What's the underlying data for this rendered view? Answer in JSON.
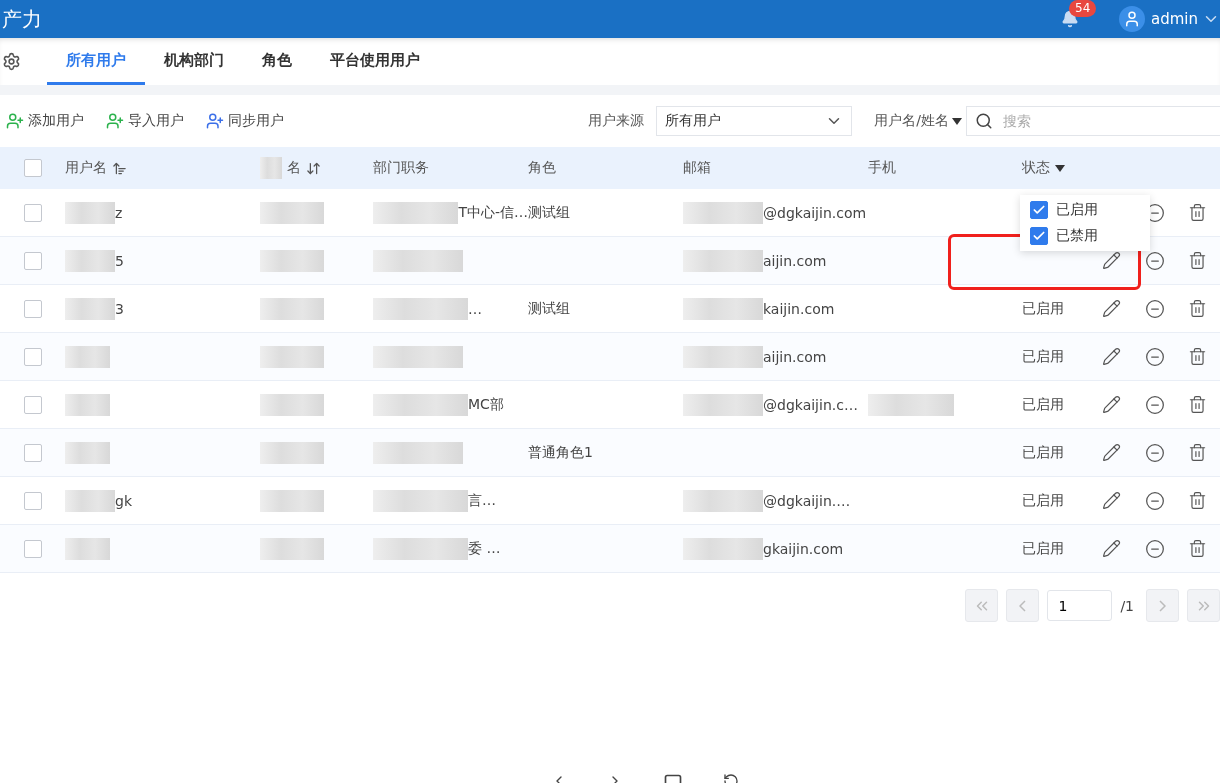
{
  "header": {
    "title": "产力",
    "notification_count": "54",
    "user": "admin"
  },
  "tabs": [
    {
      "label": "所有用户",
      "selected": true
    },
    {
      "label": "机构部门",
      "selected": false
    },
    {
      "label": "角色",
      "selected": false
    },
    {
      "label": "平台使用用户",
      "selected": false
    }
  ],
  "toolbar": {
    "actions": [
      "添加用户",
      "导入用户",
      "同步用户"
    ],
    "source_label": "用户来源",
    "source_value": "所有用户",
    "search_scope": "用户名/姓名",
    "search_placeholder": "搜索"
  },
  "table": {
    "select_all_checked": false,
    "columns": [
      "用户名",
      "名",
      "部门职务",
      "角色",
      "邮箱",
      "手机",
      "状态"
    ],
    "rows": [
      {
        "checked": false,
        "username": "z",
        "dept": "T中心-信…",
        "role": "测试组",
        "email": "@dgkaijin.com",
        "phone_redacted": false,
        "status": ""
      },
      {
        "checked": false,
        "username": "5",
        "dept": "",
        "role": "",
        "email": "aijin.com",
        "phone_redacted": false,
        "status": ""
      },
      {
        "checked": false,
        "username": "3",
        "dept": "…",
        "role": "测试组",
        "email": "kaijin.com",
        "phone_redacted": false,
        "status": "已启用"
      },
      {
        "checked": false,
        "username": "",
        "dept": "",
        "role": "",
        "email": "aijin.com",
        "phone_redacted": false,
        "status": "已启用"
      },
      {
        "checked": false,
        "username": "",
        "dept": "MC部",
        "role": "",
        "email": "@dgkaijin.c…",
        "phone_redacted": true,
        "status": "已启用"
      },
      {
        "checked": false,
        "username": "",
        "dept": "",
        "role": "普通角色1",
        "email": "",
        "phone_redacted": false,
        "status": "已启用"
      },
      {
        "checked": false,
        "username": "gk",
        "dept": "言…",
        "role": "",
        "email": "@dgkaijin.…",
        "phone_redacted": false,
        "status": "已启用"
      },
      {
        "checked": false,
        "username": "",
        "dept": "委 …",
        "role": "",
        "email": "gkaijin.com",
        "phone_redacted": false,
        "status": "已启用"
      }
    ]
  },
  "status_filter": {
    "options": [
      {
        "label": "已启用",
        "checked": true
      },
      {
        "label": "已禁用",
        "checked": true
      }
    ],
    "highlight": true
  },
  "pagination": {
    "page": "1",
    "total": "/1"
  }
}
